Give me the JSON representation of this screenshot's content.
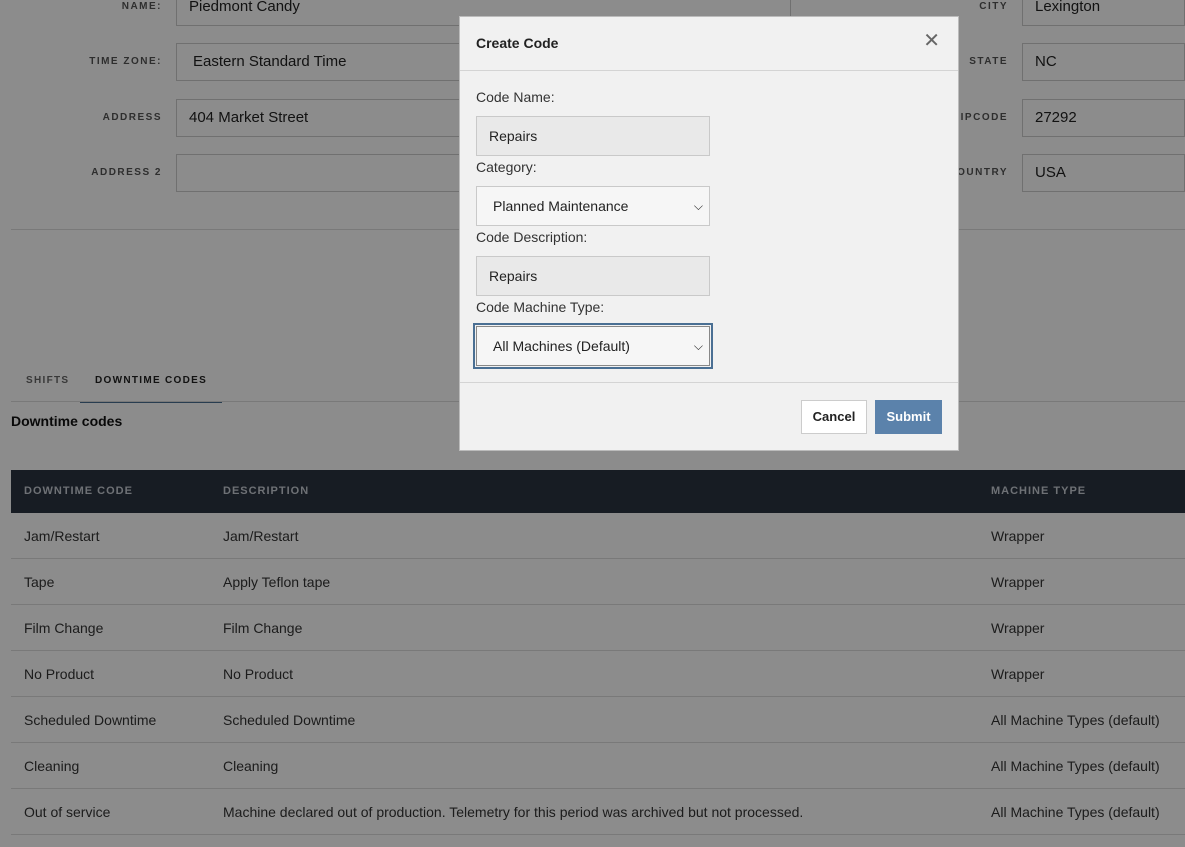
{
  "form": {
    "name_label": "NAME:",
    "name_value": "Piedmont Candy",
    "timezone_label": "TIME ZONE:",
    "timezone_value": "Eastern Standard Time",
    "address_label": "ADDRESS",
    "address_value": "404 Market Street",
    "address2_label": "ADDRESS 2",
    "address2_value": "",
    "city_label": "CITY",
    "city_value": "Lexington",
    "state_label": "STATE",
    "state_value": "NC",
    "zip_label": "ZIPCODE",
    "zip_value": "27292",
    "country_label": "COUNTRY",
    "country_value": "USA"
  },
  "tabs": [
    {
      "label": "SHIFTS"
    },
    {
      "label": "DOWNTIME CODES"
    }
  ],
  "section_title": "Downtime codes",
  "table": {
    "headers": [
      "DOWNTIME CODE",
      "DESCRIPTION",
      "MACHINE TYPE"
    ],
    "rows": [
      [
        "Jam/Restart",
        "Jam/Restart",
        "Wrapper"
      ],
      [
        "Tape",
        "Apply Teflon tape",
        "Wrapper"
      ],
      [
        "Film Change",
        "Film Change",
        "Wrapper"
      ],
      [
        "No Product",
        "No Product",
        "Wrapper"
      ],
      [
        "Scheduled Downtime",
        "Scheduled Downtime",
        "All Machine Types (default)"
      ],
      [
        "Cleaning",
        "Cleaning",
        "All Machine Types (default)"
      ],
      [
        "Out of service",
        "Machine declared out of production. Telemetry for this period was archived but not processed.",
        "All Machine Types (default)"
      ]
    ]
  },
  "modal": {
    "title": "Create Code",
    "close_icon": "✕",
    "code_name_label": "Code Name:",
    "code_name_value": "Repairs",
    "category_label": "Category:",
    "category_value": "Planned Maintenance",
    "description_label": "Code Description:",
    "description_value": "Repairs",
    "machine_type_label": "Code Machine Type:",
    "machine_type_value": "All Machines (Default)",
    "cancel_label": "Cancel",
    "submit_label": "Submit"
  },
  "colors": {
    "table_header_bg": "#2a3441",
    "accent": "#5b82ab",
    "tab_underline": "#4a6f93"
  }
}
